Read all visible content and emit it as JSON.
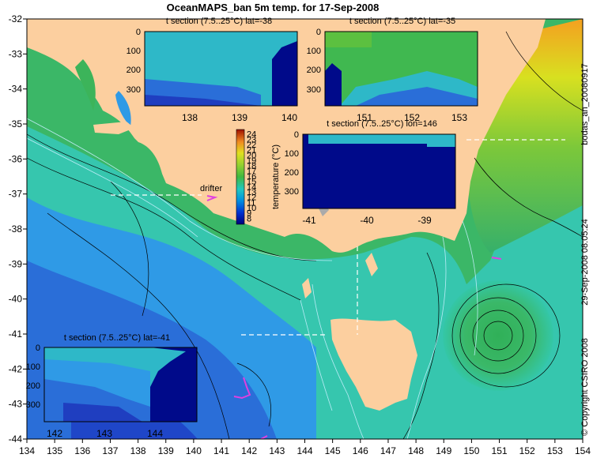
{
  "title": "OceanMAPS_ban 5m temp. for 17-Sep-2008",
  "right_labels": {
    "run_id": "bodas_an_20080917",
    "timestamp": "29-Sep-2008 08:05:24",
    "copyright": "© Copyright CSIRO 2008"
  },
  "map": {
    "lon_range": [
      134,
      154
    ],
    "lat_range": [
      -44,
      -32
    ],
    "lon_ticks": [
      134,
      135,
      136,
      137,
      138,
      139,
      140,
      141,
      142,
      143,
      144,
      145,
      146,
      147,
      148,
      149,
      150,
      151,
      152,
      153,
      154
    ],
    "lat_ticks": [
      -32,
      -33,
      -34,
      -35,
      -36,
      -37,
      -38,
      -39,
      -40,
      -41,
      -42,
      -43,
      -44
    ],
    "drifter_label": "drifter"
  },
  "colorbar": {
    "label": "temperature (°C)",
    "range": [
      7,
      25
    ],
    "ticks": [
      8,
      9,
      10,
      11,
      12,
      13,
      14,
      15,
      16,
      17,
      18,
      19,
      20,
      21,
      22,
      23,
      24
    ]
  },
  "sections": [
    {
      "id": "s-lat-38",
      "title": "t section (7.5..25°C) lat=-38",
      "x_ticks": [
        "138",
        "139",
        "140"
      ],
      "y_ticks": [
        "0",
        "100",
        "200",
        "300"
      ]
    },
    {
      "id": "s-lat-35",
      "title": "t section (7.5..25°C) lat=-35",
      "x_ticks": [
        "151",
        "152",
        "153"
      ],
      "y_ticks": [
        "0",
        "100",
        "200",
        "300"
      ]
    },
    {
      "id": "s-lon-146",
      "title": "t section (7.5..25°C) lon=146",
      "x_ticks": [
        "-41",
        "-40",
        "-39"
      ],
      "y_ticks": [
        "0",
        "100",
        "200",
        "300"
      ]
    },
    {
      "id": "s-lat-41",
      "title": "t section (7.5..25°C) lat=-41",
      "x_ticks": [
        "142",
        "143",
        "144"
      ],
      "y_ticks": [
        "0",
        "100",
        "200",
        "300"
      ]
    }
  ],
  "colors": {
    "land": "#fccf9f",
    "deep_water": "#000a8a",
    "warm": "#f29a22",
    "drifter": "#e040e0"
  }
}
